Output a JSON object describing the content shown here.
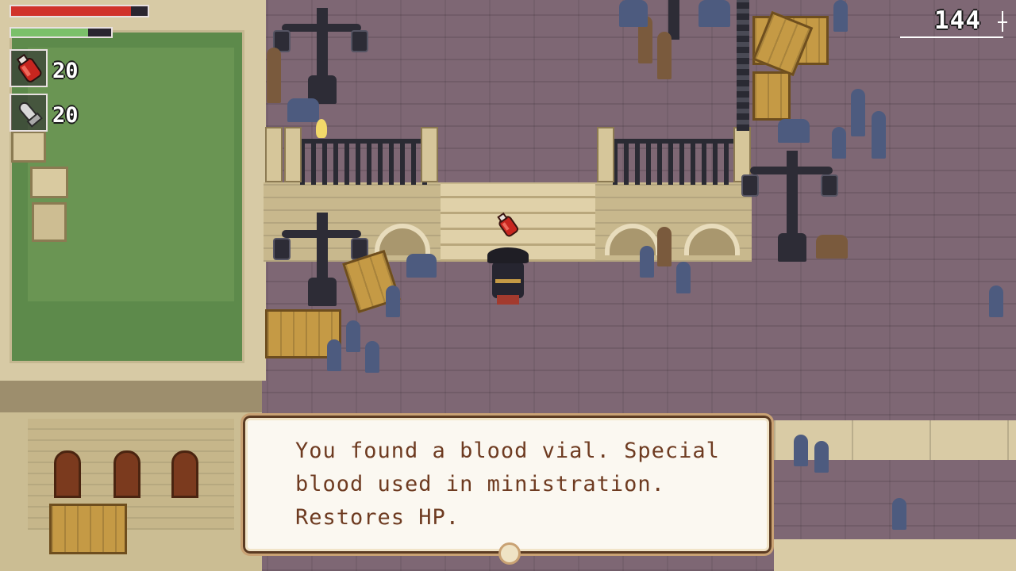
{
  "hud": {
    "health_fraction": 0.88,
    "stamina_fraction": 0.77,
    "inventory": [
      {
        "item_icon": "blood-vial-icon",
        "count": "20"
      },
      {
        "item_icon": "quicksilver-bullet-icon",
        "count": "20"
      }
    ],
    "blood_echoes": "144"
  },
  "dialog": {
    "lines": [
      "You found a blood vial. Special",
      "blood used in ministration.",
      "Restores HP."
    ]
  },
  "colors": {
    "health": "#d0322b",
    "stamina": "#7bc06a",
    "dialog_text": "#6e3b21",
    "dialog_border": "#c9a274"
  }
}
